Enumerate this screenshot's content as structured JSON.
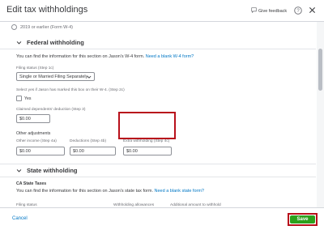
{
  "header": {
    "title": "Edit tax withholdings",
    "feedback_label": "Give feedback"
  },
  "w4_option": {
    "label": "2019 or earlier (Form W-4)"
  },
  "federal": {
    "section_title": "Federal withholding",
    "intro": "You can find the information for this section on Jason's W-4 form.",
    "intro_link": "Need a blank W-4 form?",
    "filing_status": {
      "label": "Filing status (Step 1c)",
      "value": "Single or Married Filing Separately"
    },
    "step2": {
      "label": "Select yes if Jason has marked this box on their W-4. (Step 2c)",
      "checkbox_label": "Yes"
    },
    "dependents": {
      "label": "Claimed dependents' deduction (Step 3)",
      "value": "$0.00"
    },
    "other_adjustments": {
      "title": "Other adjustments",
      "other_income": {
        "label": "Other income (Step 4a)",
        "value": "$0.00"
      },
      "deductions": {
        "label": "Deductions (Step 4b)",
        "value": "$0.00"
      },
      "extra_withholding": {
        "label": "Extra withholding (Step 4c)",
        "value": "$0.00"
      }
    }
  },
  "state": {
    "section_title": "State withholding",
    "subtitle": "CA State Taxes",
    "intro": "You can find the information for this section on Jason's state tax form.",
    "intro_link": "Need a blank state form?",
    "columns": [
      "Filing status",
      "Withholding allowances",
      "Additional amount to withhold"
    ]
  },
  "footer": {
    "cancel_label": "Cancel",
    "save_label": "Save"
  },
  "colors": {
    "link": "#0077c5",
    "save": "#2ca01c",
    "highlight": "#b8101b"
  }
}
